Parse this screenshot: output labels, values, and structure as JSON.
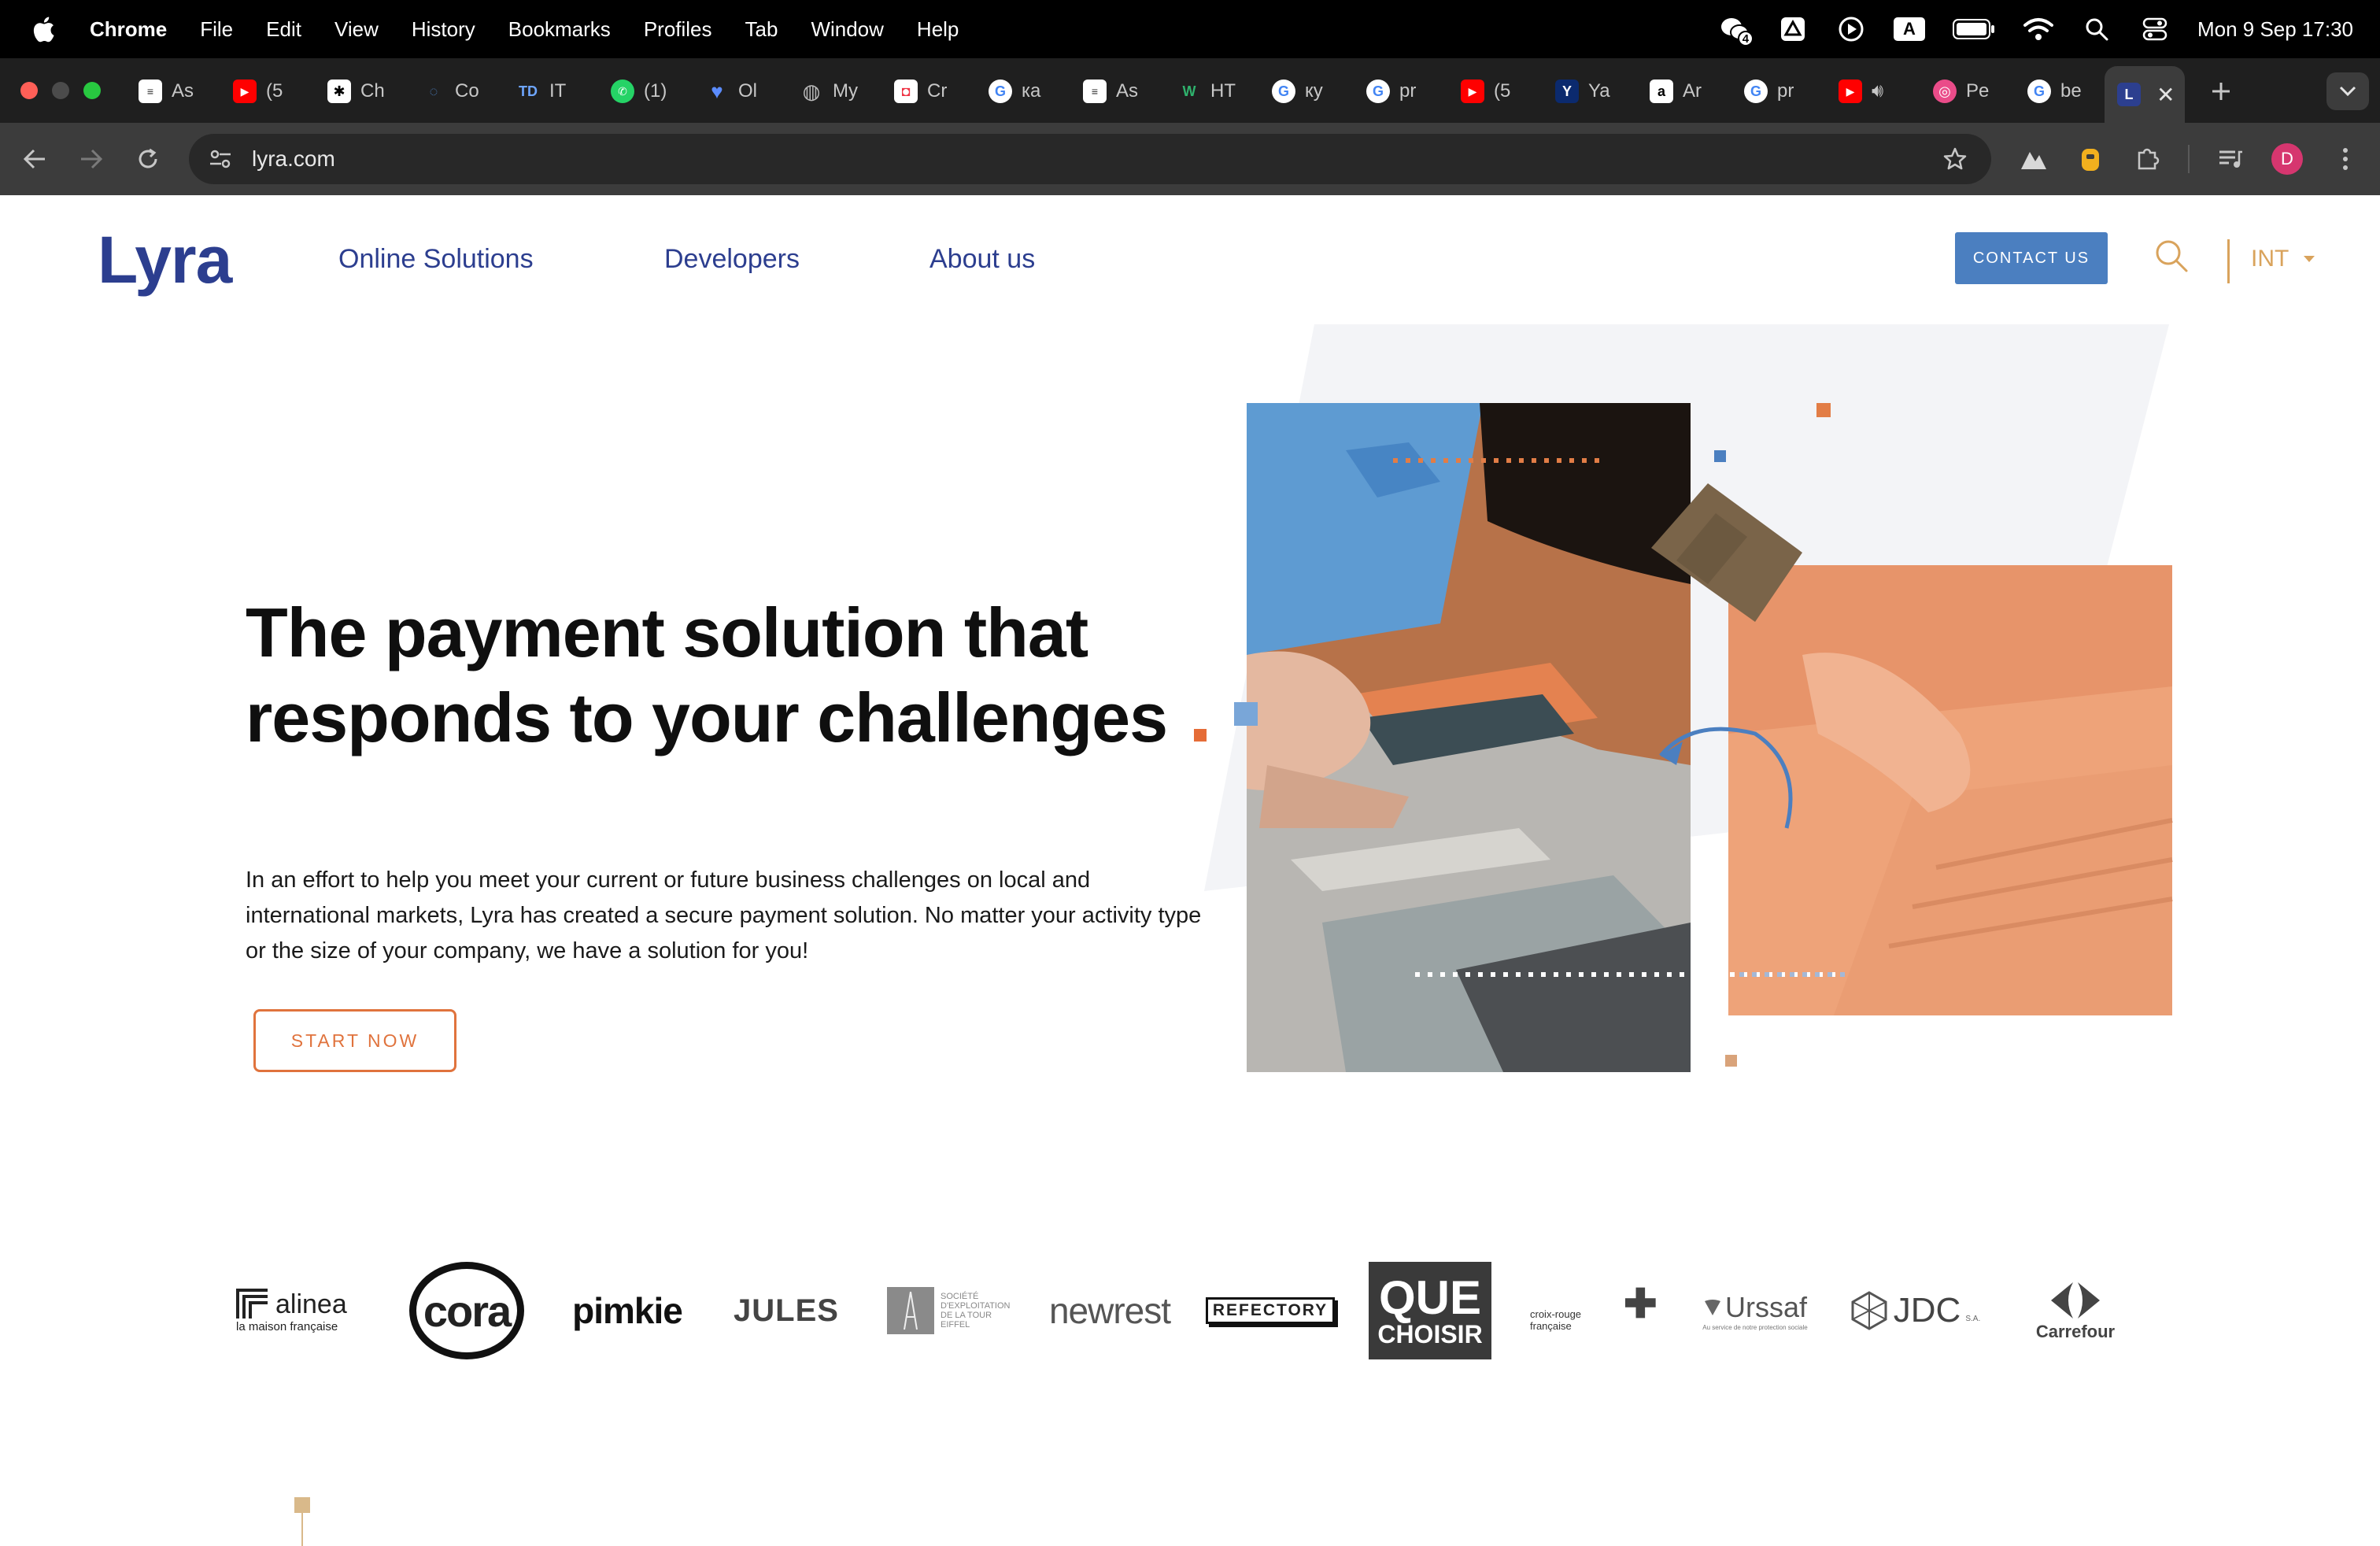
{
  "menubar": {
    "app_name": "Chrome",
    "items": [
      "File",
      "Edit",
      "View",
      "History",
      "Bookmarks",
      "Profiles",
      "Tab",
      "Window",
      "Help"
    ],
    "status_badge": "4",
    "keyboard_indicator": "A",
    "clock": "Mon 9 Sep  17:30"
  },
  "tabs": [
    {
      "title": "As",
      "favicon": "page-icon"
    },
    {
      "title": "(5",
      "favicon": "youtube-icon"
    },
    {
      "title": "Ch",
      "favicon": "openai-icon"
    },
    {
      "title": "Co",
      "favicon": "spinner-icon"
    },
    {
      "title": "IT",
      "favicon": "TD"
    },
    {
      "title": "(1)",
      "favicon": "whatsapp-icon"
    },
    {
      "title": "Ol",
      "favicon": "heart-icon"
    },
    {
      "title": "My",
      "favicon": "globe-icon"
    },
    {
      "title": "Cr",
      "favicon": "chat-icon"
    },
    {
      "title": "ка",
      "favicon": "google-icon"
    },
    {
      "title": "As",
      "favicon": "page-icon"
    },
    {
      "title": "HT",
      "favicon": "w-icon"
    },
    {
      "title": "ку",
      "favicon": "google-icon"
    },
    {
      "title": "pr",
      "favicon": "google-icon"
    },
    {
      "title": "(5",
      "favicon": "youtube-icon"
    },
    {
      "title": "Ya",
      "favicon": "Y"
    },
    {
      "title": "Ar",
      "favicon": "a"
    },
    {
      "title": "pr",
      "favicon": "google-icon"
    },
    {
      "title": "",
      "favicon": "youtube-icon"
    },
    {
      "title": "Pe",
      "favicon": "dribbble-icon"
    },
    {
      "title": "be",
      "favicon": "google-icon"
    }
  ],
  "active_tab": {
    "favicon_letter": "L"
  },
  "toolbar": {
    "url": "lyra.com",
    "profile_initial": "D"
  },
  "site": {
    "logo": "Lyra",
    "nav": [
      "Online Solutions",
      "Developers",
      "About us"
    ],
    "contact_label": "CONTACT US",
    "lang": "INT",
    "hero": {
      "title": "The payment solution that responds to your challenges",
      "text": "In an effort to help you meet your current or future business challenges on local and international markets, Lyra has created a secure payment solution. No matter your activity type or the size of your company, we have a solution for you!",
      "cta": "START NOW"
    },
    "clients": {
      "alinea": "alinea",
      "alinea_tag": "la maison française",
      "cora": "cora",
      "pimkie": "pimkie",
      "jules": "JULES",
      "tour_eiffel": "SOCIÉTÉ D'EXPLOITATION DE LA TOUR EIFFEL",
      "newrest": "newrest",
      "refectory": "REFECTORY",
      "que": "QUE",
      "choisir": "CHOISIR",
      "croix_rouge": "croix-rouge française",
      "urssaf": "Urssaf",
      "urssaf_tag": "Au service de notre protection sociale",
      "jdc": "JDC",
      "jdc_tag": "S.A.",
      "carrefour": "Carrefour"
    }
  },
  "colors": {
    "brand_blue": "#2c3e8f",
    "accent_orange": "#e56c37",
    "contact_blue": "#4b7fc0",
    "gold": "#d9a35c"
  }
}
